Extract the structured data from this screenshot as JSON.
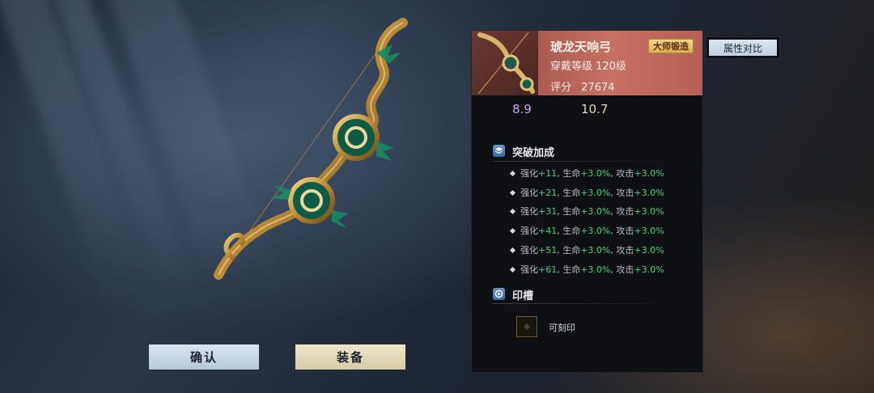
{
  "actions": {
    "confirm_label": "确认",
    "equip_label": "装备",
    "compare_label": "属性对比"
  },
  "item": {
    "name": "琥龙天响弓",
    "quality_badge": "大师锻造",
    "wear_level": "穿戴等级 120级",
    "score_label": "评分",
    "score_value": "27674",
    "stats": [
      "8.9",
      "10.7"
    ]
  },
  "breakthrough": {
    "title": "突破加成",
    "rows": [
      {
        "k1": "强化",
        "v1": "+11",
        "k2": "生命",
        "v2": "+3.0%",
        "k3": "攻击",
        "v3": "+3.0%"
      },
      {
        "k1": "强化",
        "v1": "+21",
        "k2": "生命",
        "v2": "+3.0%",
        "k3": "攻击",
        "v3": "+3.0%"
      },
      {
        "k1": "强化",
        "v1": "+31",
        "k2": "生命",
        "v2": "+3.0%",
        "k3": "攻击",
        "v3": "+3.0%"
      },
      {
        "k1": "强化",
        "v1": "+41",
        "k2": "生命",
        "v2": "+3.0%",
        "k3": "攻击",
        "v3": "+3.0%"
      },
      {
        "k1": "强化",
        "v1": "+51",
        "k2": "生命",
        "v2": "+3.0%",
        "k3": "攻击",
        "v3": "+3.0%"
      },
      {
        "k1": "强化",
        "v1": "+61",
        "k2": "生命",
        "v2": "+3.0%",
        "k3": "攻击",
        "v3": "+3.0%"
      }
    ]
  },
  "seal": {
    "title": "印槽",
    "slot_text": "可刻印"
  },
  "icons": {
    "breakthrough": "layers-icon",
    "seal": "seal-icon",
    "slot": "empty-slot-icon"
  },
  "colors": {
    "bonus_green": "#42d27a",
    "header_red": "#c77062",
    "badge_gold": "#f6dc8e"
  }
}
